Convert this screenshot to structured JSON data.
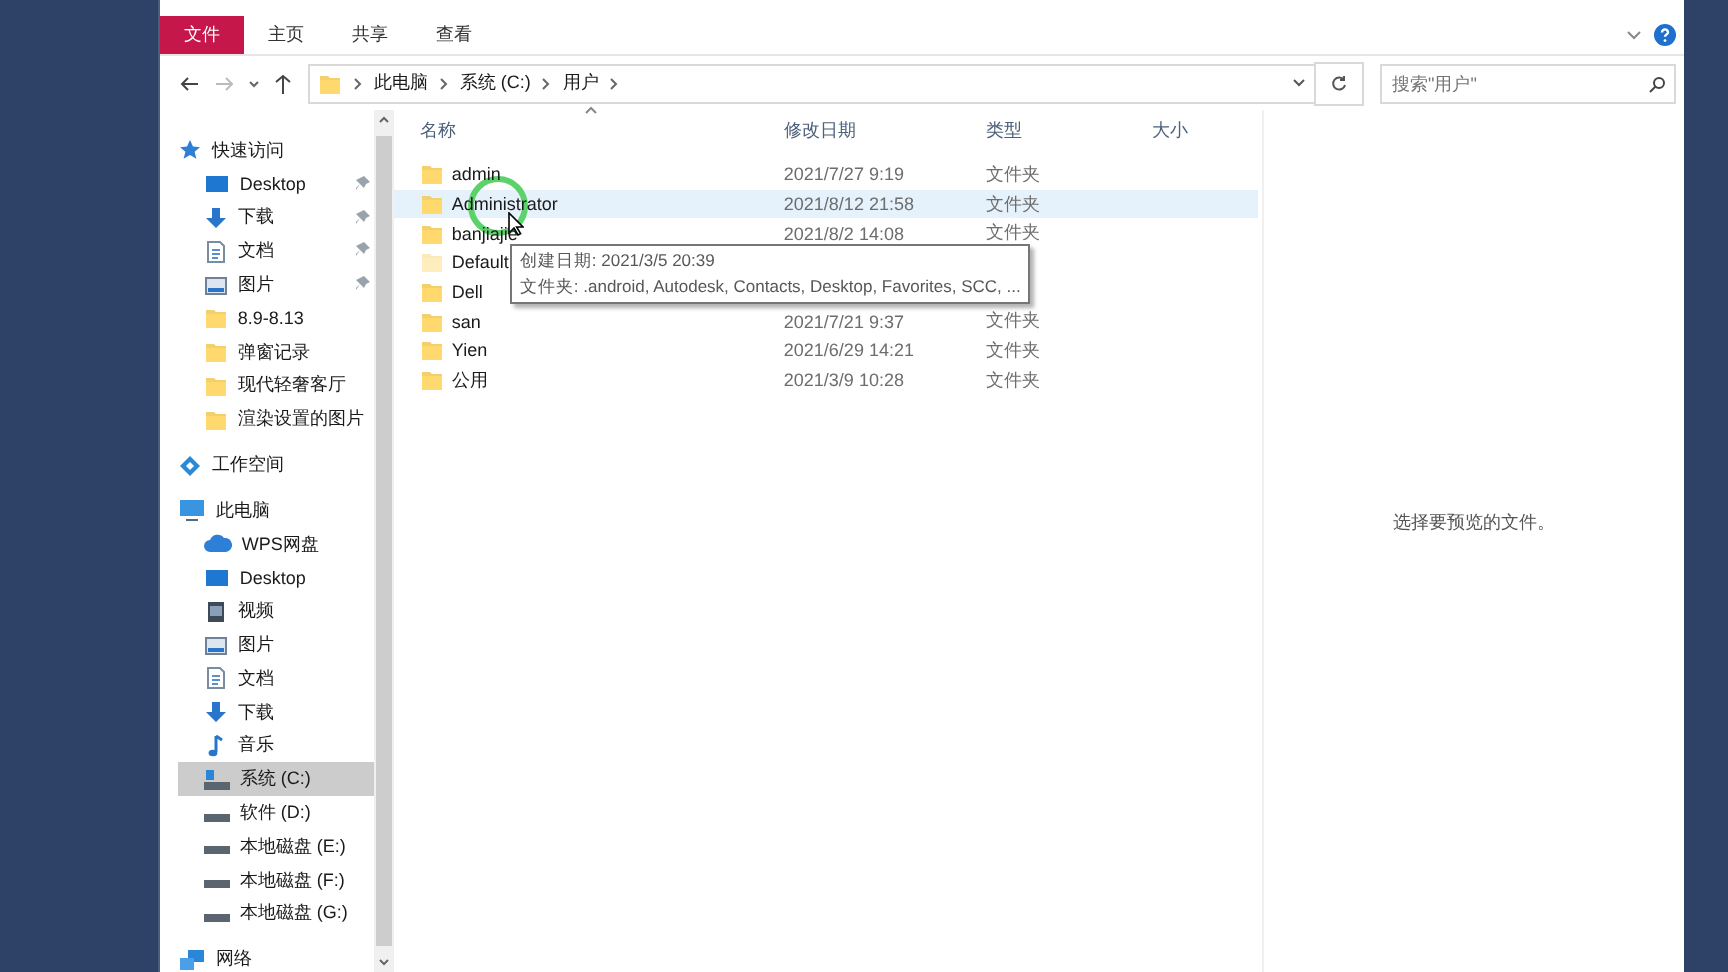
{
  "ribbon": {
    "tabs": [
      {
        "label": "文件",
        "selected": true
      },
      {
        "label": "主页",
        "selected": false
      },
      {
        "label": "共享",
        "selected": false
      },
      {
        "label": "查看",
        "selected": false
      }
    ]
  },
  "address": {
    "crumbs": [
      "此电脑",
      "系统 (C:)",
      "用户"
    ]
  },
  "search": {
    "placeholder": "搜索\"用户\""
  },
  "sidebar": {
    "items": [
      {
        "label": "快速访问",
        "kind": "star",
        "selected": false,
        "children": [
          {
            "label": "Desktop",
            "kind": "desktop",
            "pinned": true,
            "selected": false
          },
          {
            "label": "下载",
            "kind": "download",
            "pinned": true,
            "selected": false
          },
          {
            "label": "文档",
            "kind": "document",
            "pinned": true,
            "selected": false
          },
          {
            "label": "图片",
            "kind": "pictures",
            "pinned": true,
            "selected": false
          },
          {
            "label": "8.9-8.13",
            "kind": "folder",
            "pinned": false,
            "selected": false
          },
          {
            "label": "弹窗记录",
            "kind": "folder",
            "pinned": false,
            "selected": false
          },
          {
            "label": "现代轻奢客厅",
            "kind": "folder",
            "pinned": false,
            "selected": false
          },
          {
            "label": "渲染设置的图片",
            "kind": "folder",
            "pinned": false,
            "selected": false
          }
        ]
      },
      {
        "label": "工作空间",
        "kind": "workspace",
        "selected": false
      },
      {
        "label": "此电脑",
        "kind": "computer",
        "selected": false,
        "children": [
          {
            "label": "WPS网盘",
            "kind": "cloud",
            "pinned": false,
            "selected": false
          },
          {
            "label": "Desktop",
            "kind": "desktop",
            "pinned": false,
            "selected": false
          },
          {
            "label": "视频",
            "kind": "video",
            "pinned": false,
            "selected": false
          },
          {
            "label": "图片",
            "kind": "pictures",
            "pinned": false,
            "selected": false
          },
          {
            "label": "文档",
            "kind": "document",
            "pinned": false,
            "selected": false
          },
          {
            "label": "下载",
            "kind": "download",
            "pinned": false,
            "selected": false
          },
          {
            "label": "音乐",
            "kind": "music",
            "pinned": false,
            "selected": false
          },
          {
            "label": "系统 (C:)",
            "kind": "system-drive",
            "pinned": false,
            "selected": true
          },
          {
            "label": "软件 (D:)",
            "kind": "drive",
            "pinned": false,
            "selected": false
          },
          {
            "label": "本地磁盘 (E:)",
            "kind": "drive",
            "pinned": false,
            "selected": false
          },
          {
            "label": "本地磁盘 (F:)",
            "kind": "drive",
            "pinned": false,
            "selected": false
          },
          {
            "label": "本地磁盘 (G:)",
            "kind": "drive",
            "pinned": false,
            "selected": false
          }
        ]
      },
      {
        "label": "网络",
        "kind": "network",
        "selected": false
      }
    ]
  },
  "file_list": {
    "columns": [
      "名称",
      "修改日期",
      "类型",
      "大小"
    ],
    "rows": [
      {
        "name": "admin",
        "modified": "2021/7/27 9:19",
        "type": "文件夹",
        "selected": false,
        "hidden": false
      },
      {
        "name": "Administrator",
        "modified": "2021/8/12 21:58",
        "type": "文件夹",
        "selected": true,
        "hidden": false
      },
      {
        "name": "banjiajie",
        "modified": "2021/8/2 14:08",
        "type": "文件夹",
        "selected": false,
        "hidden": false
      },
      {
        "name": "Default",
        "selected": false,
        "hidden": true
      },
      {
        "name": "Dell",
        "selected": false,
        "hidden": false
      },
      {
        "name": "san",
        "modified": "2021/7/21 9:37",
        "type": "文件夹",
        "selected": false,
        "hidden": false
      },
      {
        "name": "Yien",
        "modified": "2021/6/29 14:21",
        "type": "文件夹",
        "selected": false,
        "hidden": false
      },
      {
        "name": "公用",
        "modified": "2021/3/9 10:28",
        "type": "文件夹",
        "selected": false,
        "hidden": false
      }
    ]
  },
  "tooltip": {
    "lines": [
      "创建日期: 2021/3/5 20:39",
      "文件夹: .android, Autodesk, Contacts, Desktop, Favorites, SCC, ..."
    ]
  },
  "preview": {
    "message": "选择要预览的文件。"
  }
}
